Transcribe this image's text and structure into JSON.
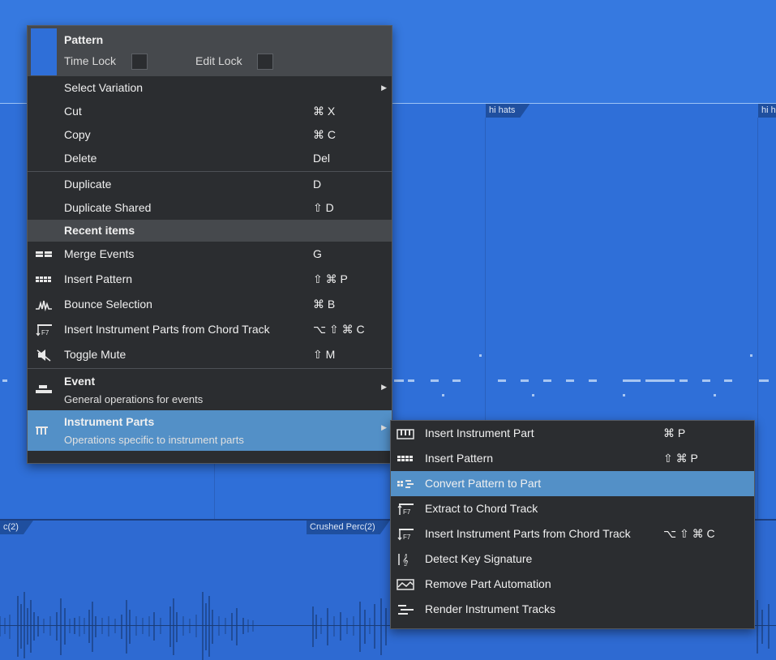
{
  "timeline": {
    "top_tag": "hi hats",
    "top_tag_right": "hi hats",
    "bottom_tag_left": "c(2)",
    "bottom_tag_mid": "Crushed Perc(2)"
  },
  "context_menu": {
    "header": {
      "title": "Pattern",
      "time_lock_label": "Time Lock",
      "edit_lock_label": "Edit Lock"
    },
    "items": [
      {
        "label": "Select Variation",
        "shortcut": "",
        "submenu": true
      },
      {
        "label": "Cut",
        "shortcut": "⌘ X"
      },
      {
        "label": "Copy",
        "shortcut": "⌘ C"
      },
      {
        "label": "Delete",
        "shortcut": "Del"
      },
      {
        "label": "Duplicate",
        "shortcut": "D"
      },
      {
        "label": "Duplicate Shared",
        "shortcut": "⇧ D"
      }
    ],
    "recent_section_label": "Recent items",
    "recent_items": [
      {
        "label": "Merge Events",
        "shortcut": "G",
        "icon": "merge-events-icon"
      },
      {
        "label": "Insert Pattern",
        "shortcut": "⇧ ⌘ P",
        "icon": "pattern-icon"
      },
      {
        "label": "Bounce Selection",
        "shortcut": "⌘ B",
        "icon": "bounce-icon"
      },
      {
        "label": "Insert Instrument Parts from Chord Track",
        "shortcut": "⌥ ⇧ ⌘ C",
        "icon": "chord-track-icon"
      },
      {
        "label": "Toggle Mute",
        "shortcut": "⇧ M",
        "icon": "mute-icon"
      }
    ],
    "groups": [
      {
        "title": "Event",
        "subtitle": "General operations for events",
        "icon": "event-icon"
      },
      {
        "title": "Instrument Parts",
        "subtitle": "Operations specific to instrument parts",
        "icon": "instrument-parts-icon",
        "active": true
      }
    ]
  },
  "submenu": {
    "items": [
      {
        "label": "Insert Instrument Part",
        "shortcut": "⌘ P",
        "icon": "piano-keys-icon"
      },
      {
        "label": "Insert Pattern",
        "shortcut": "⇧ ⌘ P",
        "icon": "pattern-icon"
      },
      {
        "label": "Convert Pattern to Part",
        "shortcut": "",
        "icon": "convert-pattern-icon",
        "active": true
      },
      {
        "label": "Extract to Chord Track",
        "shortcut": "",
        "icon": "extract-chord-icon"
      },
      {
        "label": "Insert Instrument Parts from Chord Track",
        "shortcut": "⌥ ⇧ ⌘ C",
        "icon": "chord-track-icon"
      },
      {
        "label": "Detect Key Signature",
        "shortcut": "",
        "icon": "key-signature-icon"
      },
      {
        "label": "Remove Part Automation",
        "shortcut": "",
        "icon": "automation-icon"
      },
      {
        "label": "Render Instrument Tracks",
        "shortcut": "",
        "icon": "render-tracks-icon"
      }
    ]
  },
  "colors": {
    "accent_selected": "#5390c7",
    "event_blue": "#2f6fd8",
    "menu_bg": "#2b2d30"
  }
}
